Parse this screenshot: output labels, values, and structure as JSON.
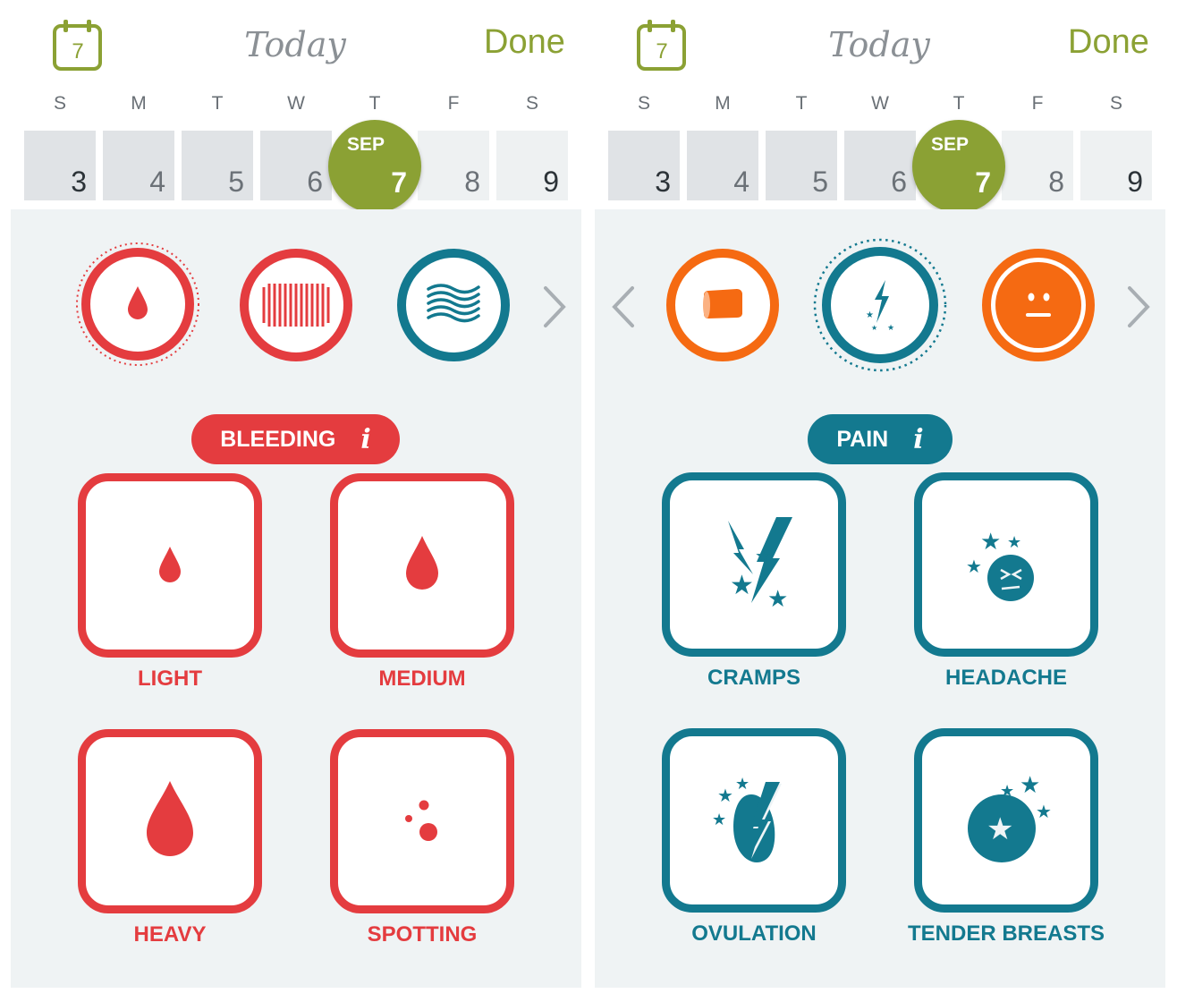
{
  "colors": {
    "accent_green": "#8ba134",
    "bleeding_red": "#e43c3f",
    "pain_teal": "#13798f",
    "orange": "#f56a12"
  },
  "panels": [
    {
      "header": {
        "calendar_day": "7",
        "title": "Today",
        "done_label": "Done"
      },
      "week": {
        "day_letters": [
          "S",
          "M",
          "T",
          "W",
          "T",
          "F",
          "S"
        ],
        "dates": [
          "3",
          "4",
          "5",
          "6",
          "7",
          "8",
          "9"
        ],
        "selected_month": "SEP",
        "selected_date": "7"
      },
      "category_icons": [
        "blood-drop-icon",
        "pad-icon",
        "discharge-icon"
      ],
      "category": {
        "label": "BLEEDING",
        "info": "i"
      },
      "options": [
        {
          "label": "LIGHT",
          "icon": "small-drop-icon"
        },
        {
          "label": "MEDIUM",
          "icon": "medium-drop-icon"
        },
        {
          "label": "HEAVY",
          "icon": "large-drop-icon"
        },
        {
          "label": "SPOTTING",
          "icon": "spots-icon"
        }
      ]
    },
    {
      "header": {
        "calendar_day": "7",
        "title": "Today",
        "done_label": "Done"
      },
      "week": {
        "day_letters": [
          "S",
          "M",
          "T",
          "W",
          "T",
          "F",
          "S"
        ],
        "dates": [
          "3",
          "4",
          "5",
          "6",
          "7",
          "8",
          "9"
        ],
        "selected_month": "SEP",
        "selected_date": "7"
      },
      "category_icons": [
        "tampon-icon",
        "pain-bolt-icon",
        "mood-face-icon"
      ],
      "category": {
        "label": "PAIN",
        "info": "i"
      },
      "options": [
        {
          "label": "CRAMPS",
          "icon": "cramps-icon"
        },
        {
          "label": "HEADACHE",
          "icon": "headache-icon"
        },
        {
          "label": "OVULATION",
          "icon": "ovulation-icon"
        },
        {
          "label": "TENDER BREASTS",
          "icon": "tender-breasts-icon"
        }
      ]
    }
  ]
}
